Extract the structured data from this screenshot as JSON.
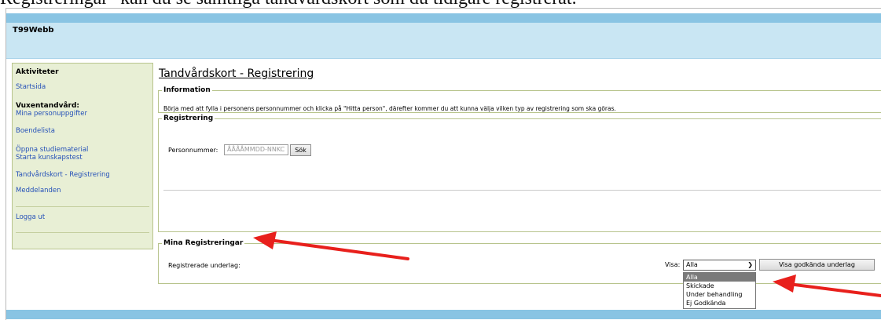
{
  "caption": "Registreringar\" kan du se samtliga tandvårdskort som du tidigare registrerat.",
  "app": {
    "title": "T99Webb"
  },
  "sidebar": {
    "heading": "Aktiviteter",
    "startsida": "Startsida",
    "section_heading": "Vuxentandvård:",
    "mina_personuppgifter": "Mina personuppgifter",
    "boendelista": "Boendelista",
    "oppna_studiematerial": "Öppna studiematerial",
    "starta_kunskapstest": "Starta kunskapstest",
    "tandvardskort": "Tandvårdskort - Registrering",
    "meddelanden": "Meddelanden",
    "logga_ut": "Logga ut"
  },
  "main": {
    "page_title": "Tandvårdskort - Registrering",
    "information": {
      "legend": "Information",
      "text": "Börja med att fylla i personens personnummer och klicka på \"Hitta person\", därefter kommer du att kunna välja vilken typ av registrering som ska göras."
    },
    "registrering": {
      "legend": "Registrering",
      "personnummer_label": "Personnummer:",
      "personnummer_placeholder": "ÅÅÅÅMMDD-NNKC",
      "sok_button": "Sök"
    },
    "mina_registreringar": {
      "legend": "Mina Registreringar",
      "registrerade_label": "Registrerade underlag:",
      "visa_label": "Visa:",
      "visa_selected": "Alla",
      "visa_options": [
        "Alla",
        "Skickade",
        "Under behandling",
        "Ej Godkända"
      ],
      "visa_godkanda_button": "Visa godkända underlag"
    }
  },
  "colors": {
    "header_light": "#c9e6f3",
    "header_dark": "#89c4e3",
    "sidebar_bg": "#e8efd5",
    "fieldset_border": "#b8c48d",
    "link": "#2450b8",
    "annotation_arrow": "#e8201c"
  }
}
